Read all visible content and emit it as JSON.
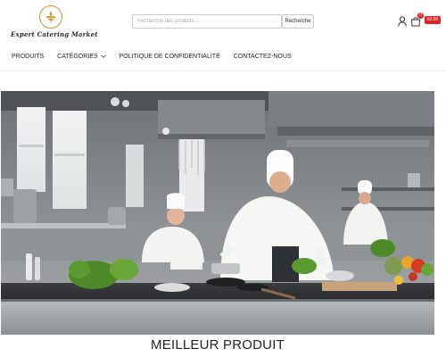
{
  "header": {
    "logo_text": "Expert Catering Market",
    "logo_icon": "fleur-de-lis-icon"
  },
  "search": {
    "placeholder": "Recherche des produits…",
    "button_label": "Recherche"
  },
  "account": {
    "icon": "user-icon"
  },
  "cart": {
    "icon": "shopping-bag-icon",
    "count": "0",
    "total": "€0.00",
    "accent_color": "#e02222"
  },
  "nav": {
    "items": [
      {
        "label": "PRODUITS"
      },
      {
        "label": "CATÉGORIES",
        "has_dropdown": true
      },
      {
        "label": "POLITIQUE DE CONFIDENTIALITÉ"
      },
      {
        "label": "CONTACTEZ-NOUS"
      }
    ]
  },
  "hero": {
    "image_icon": "kitchen-chefs-photo"
  },
  "main": {
    "section_title": "MEILLEUR PRODUIT"
  }
}
